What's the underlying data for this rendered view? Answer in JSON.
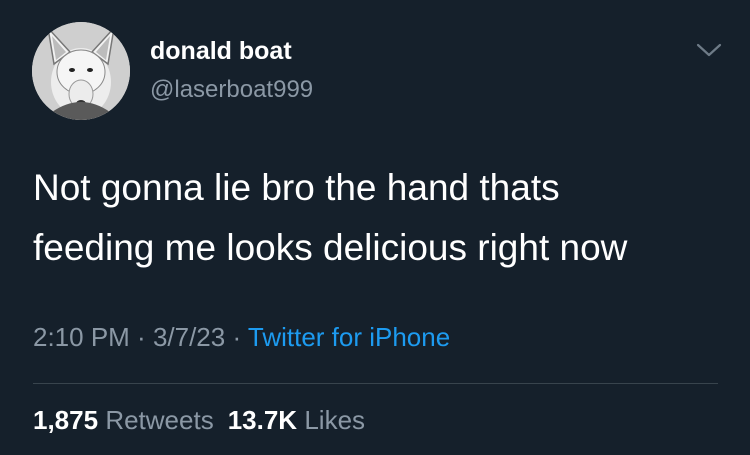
{
  "user": {
    "display_name": "donald boat",
    "handle": "@laserboat999",
    "avatar_icon": "bull-terrier-avatar"
  },
  "tweet": {
    "text_line1": "Not gonna lie bro the hand thats",
    "text_line2": "feeding me looks delicious right now"
  },
  "meta": {
    "time": "2:10 PM",
    "sep1": " · ",
    "date": "3/7/23",
    "sep2": " · ",
    "source": "Twitter for iPhone"
  },
  "stats": {
    "retweets_count": "1,875",
    "retweets_label": "Retweets",
    "likes_count": "13.7K",
    "likes_label": "Likes"
  },
  "colors": {
    "background": "#15202b",
    "secondary_text": "#8b98a5",
    "link": "#1d9bf0",
    "divider": "#38444d"
  },
  "icons": {
    "more": "chevron-down-icon"
  }
}
